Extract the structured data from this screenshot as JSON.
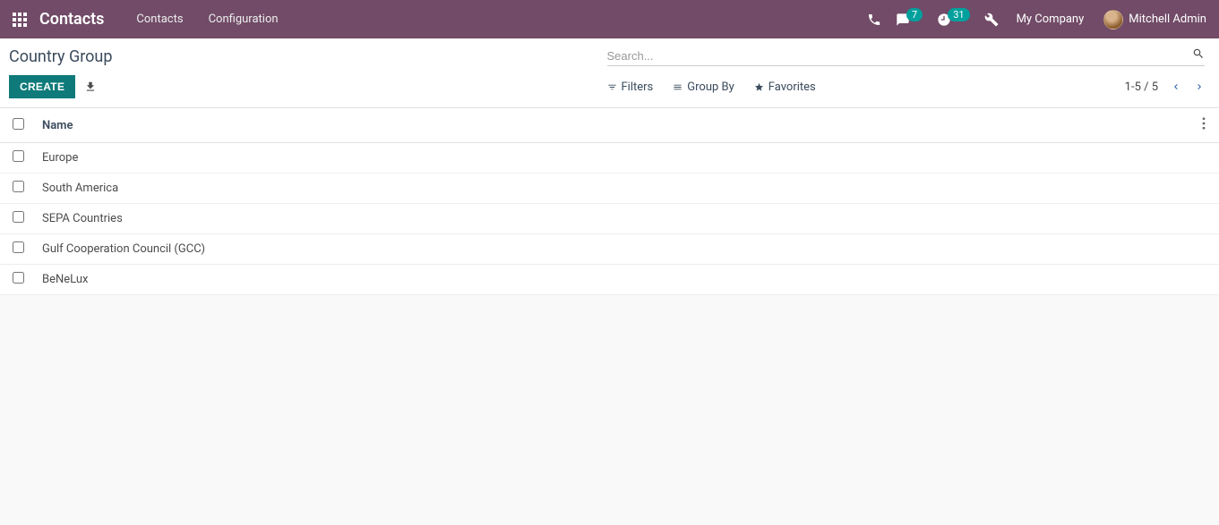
{
  "header": {
    "app_name": "Contacts",
    "menu": {
      "contacts": "Contacts",
      "configuration": "Configuration"
    },
    "messages_badge": "7",
    "activities_badge": "31",
    "company": "My Company",
    "user": "Mitchell Admin"
  },
  "control": {
    "breadcrumb": "Country Group",
    "search_placeholder": "Search...",
    "create_label": "CREATE",
    "filters_label": "Filters",
    "groupby_label": "Group By",
    "favorites_label": "Favorites",
    "pager_text": "1-5 / 5"
  },
  "table": {
    "header_name": "Name",
    "rows": [
      {
        "name": "Europe"
      },
      {
        "name": "South America"
      },
      {
        "name": "SEPA Countries"
      },
      {
        "name": "Gulf Cooperation Council (GCC)"
      },
      {
        "name": "BeNeLux"
      }
    ]
  }
}
